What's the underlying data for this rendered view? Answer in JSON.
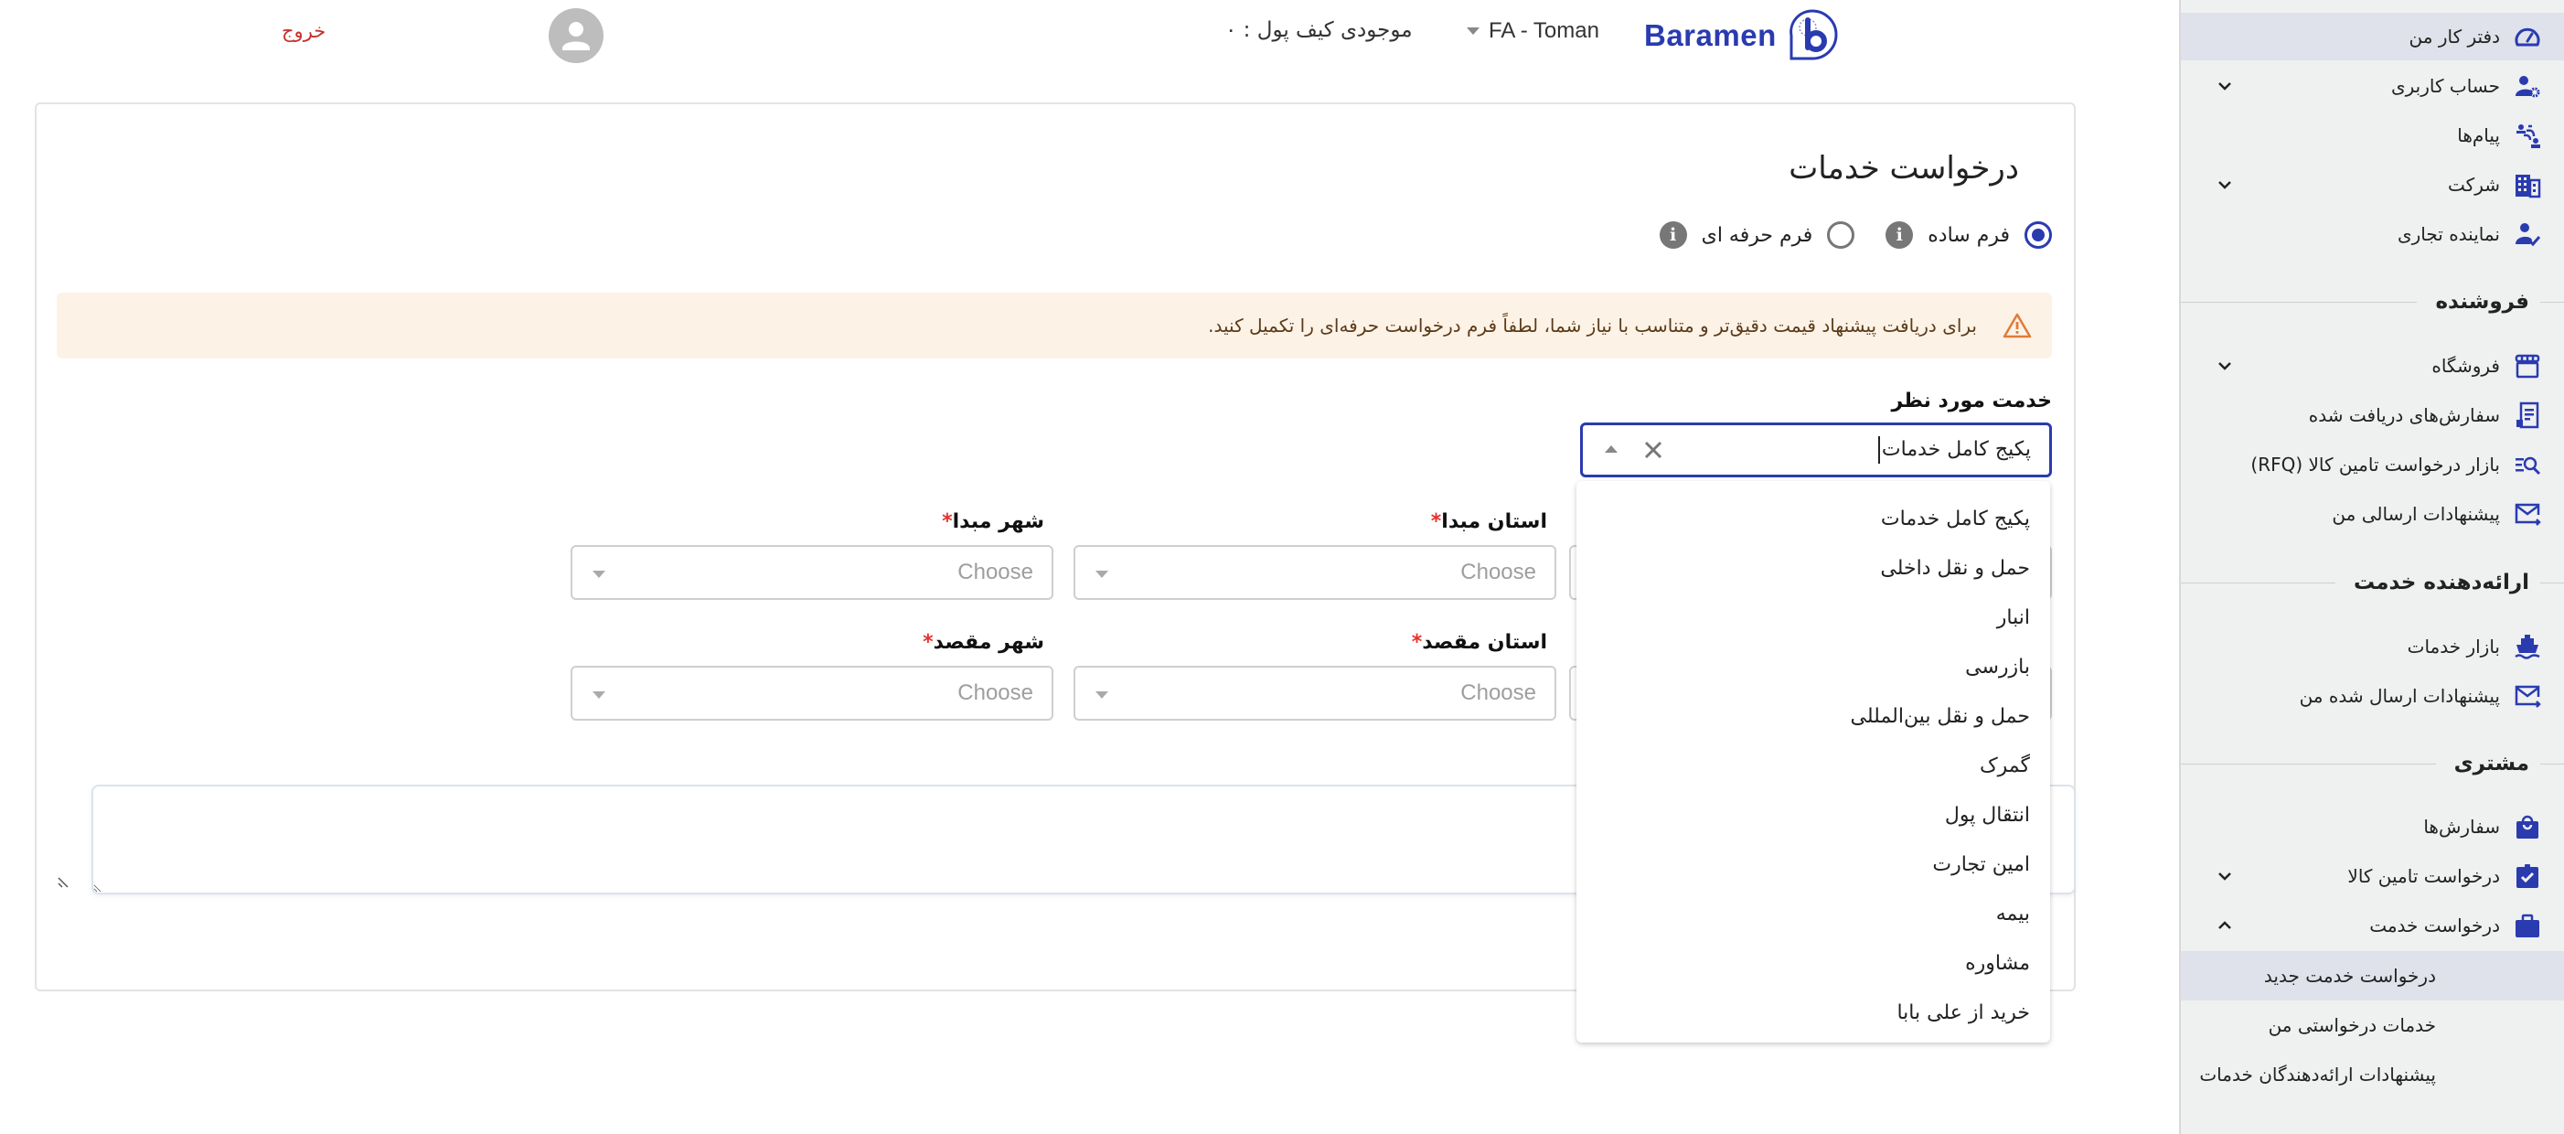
{
  "header": {
    "brand": "Baramen",
    "currency": "FA - Toman",
    "wallet_label": "موجودی کیف پول : ۰",
    "logout_label": "خروج"
  },
  "sidebar": {
    "items": [
      {
        "label": "دفتر کار من",
        "icon": "dashboard-gauge-icon",
        "active": true
      },
      {
        "label": "حساب کاربری",
        "icon": "user-settings-icon",
        "expandable": true
      },
      {
        "label": "پیام‌ها",
        "icon": "messages-icon"
      },
      {
        "label": "شرکت",
        "icon": "building-icon",
        "expandable": true
      },
      {
        "label": "نماینده تجاری",
        "icon": "user-check-icon"
      }
    ],
    "sections": [
      {
        "title": "فروشنده",
        "items": [
          {
            "label": "فروشگاه",
            "icon": "store-icon",
            "expandable": true
          },
          {
            "label": "سفارش‌های دریافت شده",
            "icon": "receipt-icon"
          },
          {
            "label": "بازار درخواست تامین کالا (RFQ)",
            "icon": "list-search-icon"
          },
          {
            "label": "پیشنهادات ارسالی من",
            "icon": "mail-send-icon"
          }
        ]
      },
      {
        "title": "ارائه‌دهنده خدمت",
        "items": [
          {
            "label": "بازار خدمات",
            "icon": "ship-icon"
          },
          {
            "label": "پیشنهادات ارسال شده من",
            "icon": "mail-send-icon"
          }
        ]
      },
      {
        "title": "مشتری",
        "items": [
          {
            "label": "سفارش‌ها",
            "icon": "shopping-bag-icon"
          },
          {
            "label": "درخواست تامین کالا",
            "icon": "clipboard-check-icon",
            "expandable": true
          },
          {
            "label": "درخواست خدمت",
            "icon": "briefcase-icon",
            "expanded": true
          }
        ]
      }
    ],
    "subitems": [
      {
        "label": "درخواست خدمت جدید",
        "active": true
      },
      {
        "label": "خدمات درخواستی من"
      },
      {
        "label": "پیشنهادات ارائه‌دهندگان خدمات"
      }
    ]
  },
  "main": {
    "title": "درخواست خدمات",
    "form_modes": [
      {
        "label": "فرم ساده",
        "selected": true
      },
      {
        "label": "فرم حرفه ای",
        "selected": false
      }
    ],
    "alert_text": "برای دریافت پیشنهاد قیمت دقیق‌تر و متناسب با نیاز شما، لطفاً فرم درخواست حرفه‌ای را تکمیل کنید.",
    "service_label": "خدمت مورد نظر",
    "service_value": "پکیج کامل خدمات",
    "fields": {
      "origin_province": {
        "label": "استان مبدا",
        "placeholder": "Choose"
      },
      "origin_city": {
        "label": "شهر مبدا",
        "placeholder": "Choose"
      },
      "dest_province": {
        "label": "استان مقصد",
        "placeholder": "Choose"
      },
      "dest_city": {
        "label": "شهر مقصد",
        "placeholder": "Choose"
      }
    },
    "required_mark": "*",
    "description_value": ""
  },
  "dropdown": {
    "options": [
      "پکیج کامل خدمات",
      "حمل و نقل داخلی",
      "انبار",
      "بازرسی",
      "حمل و نقل بین‌المللی",
      "گمرک",
      "انتقال پول",
      "امین تجارت",
      "بیمه",
      "مشاوره",
      "خرید از علی بابا"
    ]
  },
  "colors": {
    "accent": "#2a3bb0",
    "logout": "#c9302c",
    "alert_bg": "#fdf2e6",
    "alert_icon": "#e07b3a",
    "required": "#e5322d",
    "sidebar_bg": "#eff0f0",
    "sidebar_active": "#dfe2ea"
  }
}
